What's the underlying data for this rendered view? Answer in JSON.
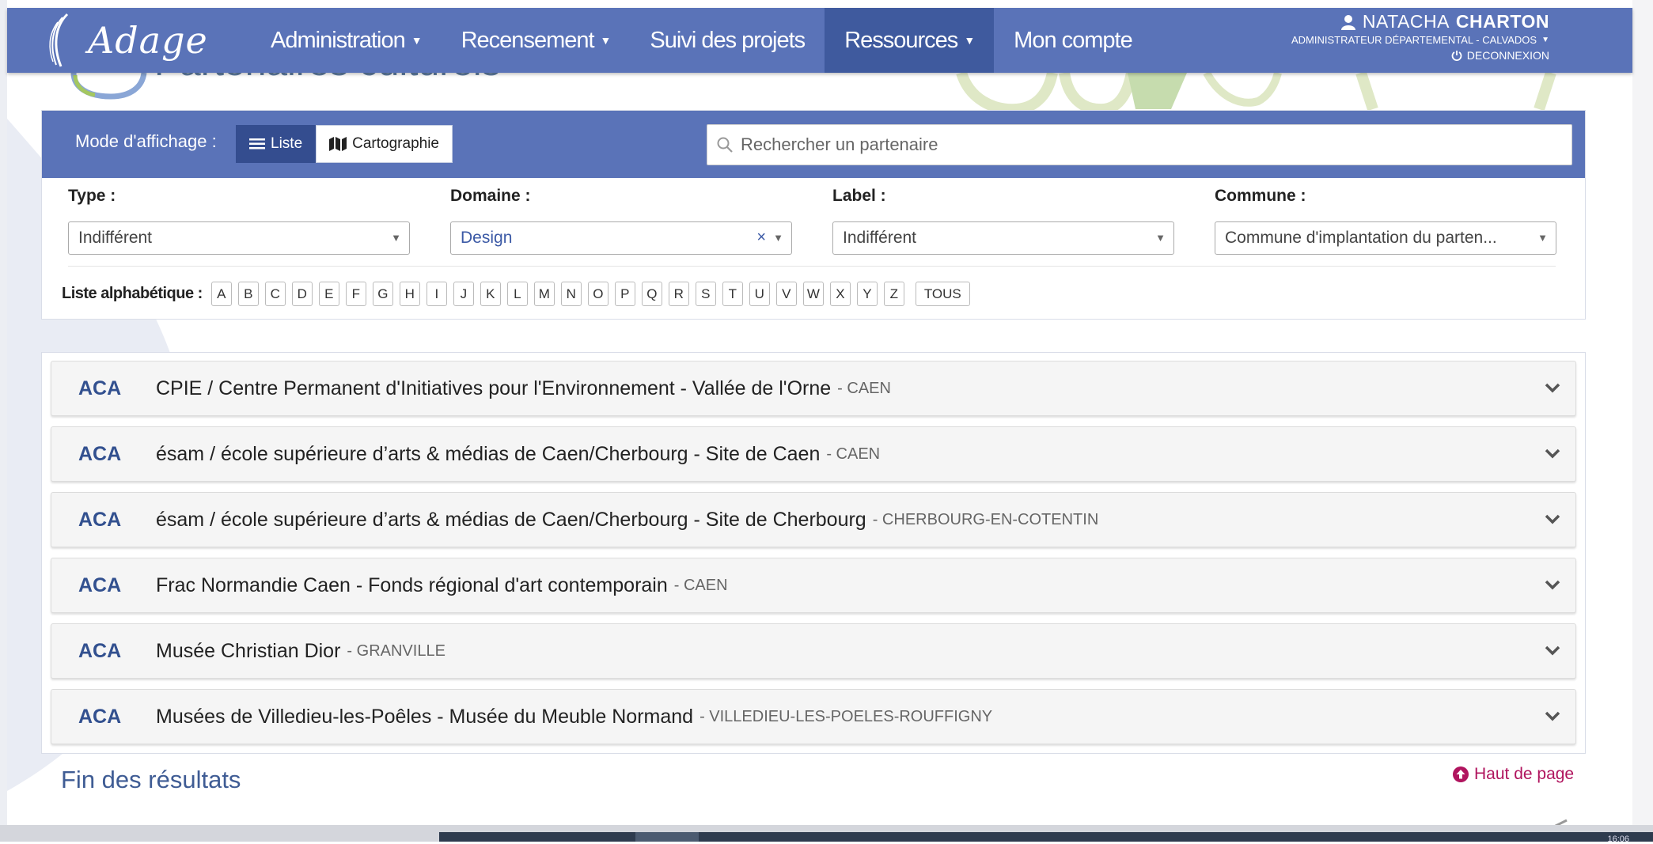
{
  "navbar": {
    "brand": "Adage",
    "items": [
      {
        "label": "Administration",
        "caret": true
      },
      {
        "label": "Recensement",
        "caret": true
      },
      {
        "label": "Suivi des projets",
        "caret": false
      },
      {
        "label": "Ressources",
        "caret": true,
        "active": true
      },
      {
        "label": "Mon compte",
        "caret": false
      }
    ],
    "user": {
      "first_name": "NATACHA",
      "last_name": "CHARTON",
      "role": "ADMINISTRATEUR DÉPARTEMENTAL - CALVADOS",
      "logout": "DECONNEXION"
    }
  },
  "page": {
    "title": "Partenaires culturels"
  },
  "filter_bar": {
    "mode_label": "Mode d'affichage :",
    "modes": [
      "Liste",
      "Cartographie"
    ],
    "search_placeholder": "Rechercher un partenaire"
  },
  "filters": {
    "type": {
      "label": "Type :",
      "value": "Indifférent"
    },
    "domaine": {
      "label": "Domaine :",
      "value": "Design",
      "clear": "×"
    },
    "label": {
      "label": "Label :",
      "value": "Indifférent"
    },
    "commune": {
      "label": "Commune :",
      "value": "Commune d'implantation du parten..."
    }
  },
  "alphabet": {
    "label": "Liste alphabétique :",
    "letters": [
      "A",
      "B",
      "C",
      "D",
      "E",
      "F",
      "G",
      "H",
      "I",
      "J",
      "K",
      "L",
      "M",
      "N",
      "O",
      "P",
      "Q",
      "R",
      "S",
      "T",
      "U",
      "V",
      "W",
      "X",
      "Y",
      "Z"
    ],
    "all": "TOUS"
  },
  "results": [
    {
      "code": "ACA",
      "name": "CPIE / Centre Permanent d'Initiatives pour l'Environnement - Vallée de l'Orne",
      "town": "- CAEN"
    },
    {
      "code": "ACA",
      "name": "ésam / école supérieure d’arts & médias de Caen/Cherbourg - Site de Caen",
      "town": "- CAEN"
    },
    {
      "code": "ACA",
      "name": "ésam / école supérieure d’arts & médias de Caen/Cherbourg - Site de Cherbourg",
      "town": "- CHERBOURG-EN-COTENTIN"
    },
    {
      "code": "ACA",
      "name": "Frac Normandie Caen - Fonds régional d'art contemporain",
      "town": "- CAEN"
    },
    {
      "code": "ACA",
      "name": "Musée Christian Dior",
      "town": "- GRANVILLE"
    },
    {
      "code": "ACA",
      "name": "Musées de Villedieu-les-Poêles - Musée du Meuble Normand",
      "town": "- VILLEDIEU-LES-POELES-ROUFFIGNY"
    }
  ],
  "footer": {
    "end_results": "Fin des résultats",
    "top_link": "Haut de page"
  },
  "taskbar": {
    "clock": "16:06"
  },
  "colors": {
    "navbar": "#5a73b8",
    "nav_active": "#3f5a9e",
    "accent_pink": "#b0145e",
    "code_blue": "#32508f"
  }
}
